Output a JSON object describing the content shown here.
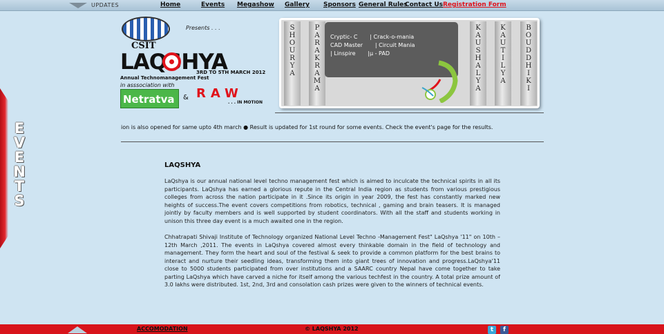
{
  "topbar": {
    "updates_label": "UPDATES",
    "nav": [
      {
        "label": "Home",
        "name": "nav-home"
      },
      {
        "label": "Events",
        "name": "nav-events"
      },
      {
        "label": "Megashow",
        "name": "nav-megashow"
      },
      {
        "label": "Gallery",
        "name": "nav-gallery"
      },
      {
        "label": "Sponsors",
        "name": "nav-sponsors"
      },
      {
        "label": "General Rules",
        "name": "nav-general-rules"
      },
      {
        "label": "Contact Us",
        "name": "nav-contact-us"
      },
      {
        "label": "Registration Form",
        "name": "nav-registration-form"
      }
    ]
  },
  "sidebar": {
    "events_tab_label": "EVENTS"
  },
  "logo": {
    "csit": "CSIT",
    "presents": "Presents . . .",
    "laqshya_word": "LAQSHYA",
    "dates": "3RD TO 5TH MARCH 2012",
    "annual": "Annual Technomanagement Fest",
    "association": "in asssociation with",
    "netratva": "Netratva",
    "amp": "&",
    "raw": "RAW",
    "raw_sub": ". . . IN MOTION"
  },
  "banner": {
    "tabs": [
      "SHOURYA",
      "PARAKRAMA",
      "KAUSHALYA",
      "KAUTILYA",
      "BOUDDHIKI"
    ],
    "events_rows": [
      "Cryptic- C       | Crack-o-mania",
      "CAD Master       | Circuit Mania",
      "| Linspire       |μ - PAD"
    ]
  },
  "ticker": "ion is also opened for same upto 4th march ●  Result is updated for 1st round for some events. Check the event's page for the results.",
  "content": {
    "title": "LAQSHYA",
    "paragraphs": [
      "LaQshya is our annual national level techno management fest which is aimed to inculcate the technical spirits in all its participants. LaQshya has earned a glorious repute in the Central India region as students from various prestigious colleges from across the nation participate in it .Since its origin in year 2009, the fest has constantly marked new heights of success.The event covers competitions from robotics, technical , gaming and brain teasers. It is managed jointly by faculty members and is well supported by student coordinators. With all the staff and students working in unison this three day event is a much awaited one in the region.",
      "Chhatrapati Shivaji Institute of Technology organized National Level Techno -Management Fest\" LaQshya '11\" on 10th – 12th March ,2011. The events in LaQshya covered almost every thinkable domain in the field of technology and management. They form the heart and soul of the festival & seek to provide a common platform for the best brains to interact and nurture their seedling ideas, transforming them into giant trees of innovation and progress.LaQshya'11 close to 5000 students participated from over institutions and a SAARC country Nepal have come together to take parting LaQshya which have carved a niche for itself among the various techfest in the country. A total prize amount of 3.0 lakhs were distributed. 1st, 2nd, 3rd and consolation cash prizes were given to the winners of technical events."
    ]
  },
  "footer": {
    "accommodation": "ACCOMODATION",
    "copyright": "© LAQSHYA 2012",
    "twitter": "t",
    "facebook": "f"
  },
  "colors": {
    "background": "#cfe4f2",
    "accent_red": "#e0121a",
    "footer_red": "#d8141b",
    "banner_grey": "#d9d9d9",
    "events_box": "#5c5c5c"
  }
}
